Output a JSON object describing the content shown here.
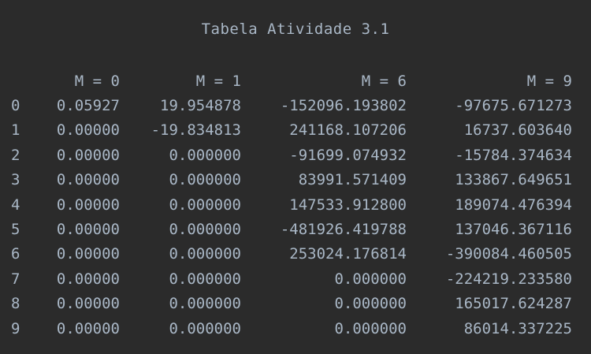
{
  "title": "Tabela Atividade 3.1",
  "table": {
    "columns": [
      "M = 0",
      "M = 1",
      "M = 6",
      "M = 9"
    ],
    "rows": [
      {
        "index": "0",
        "values": [
          "0.05927",
          "19.954878",
          "-152096.193802",
          "-97675.671273"
        ]
      },
      {
        "index": "1",
        "values": [
          "0.00000",
          "-19.834813",
          "241168.107206",
          "16737.603640"
        ]
      },
      {
        "index": "2",
        "values": [
          "0.00000",
          "0.000000",
          "-91699.074932",
          "-15784.374634"
        ]
      },
      {
        "index": "3",
        "values": [
          "0.00000",
          "0.000000",
          "83991.571409",
          "133867.649651"
        ]
      },
      {
        "index": "4",
        "values": [
          "0.00000",
          "0.000000",
          "147533.912800",
          "189074.476394"
        ]
      },
      {
        "index": "5",
        "values": [
          "0.00000",
          "0.000000",
          "-481926.419788",
          "137046.367116"
        ]
      },
      {
        "index": "6",
        "values": [
          "0.00000",
          "0.000000",
          "253024.176814",
          "-390084.460505"
        ]
      },
      {
        "index": "7",
        "values": [
          "0.00000",
          "0.000000",
          "0.000000",
          "-224219.233580"
        ]
      },
      {
        "index": "8",
        "values": [
          "0.00000",
          "0.000000",
          "0.000000",
          "165017.624287"
        ]
      },
      {
        "index": "9",
        "values": [
          "0.00000",
          "0.000000",
          "0.000000",
          "86014.337225"
        ]
      }
    ]
  }
}
